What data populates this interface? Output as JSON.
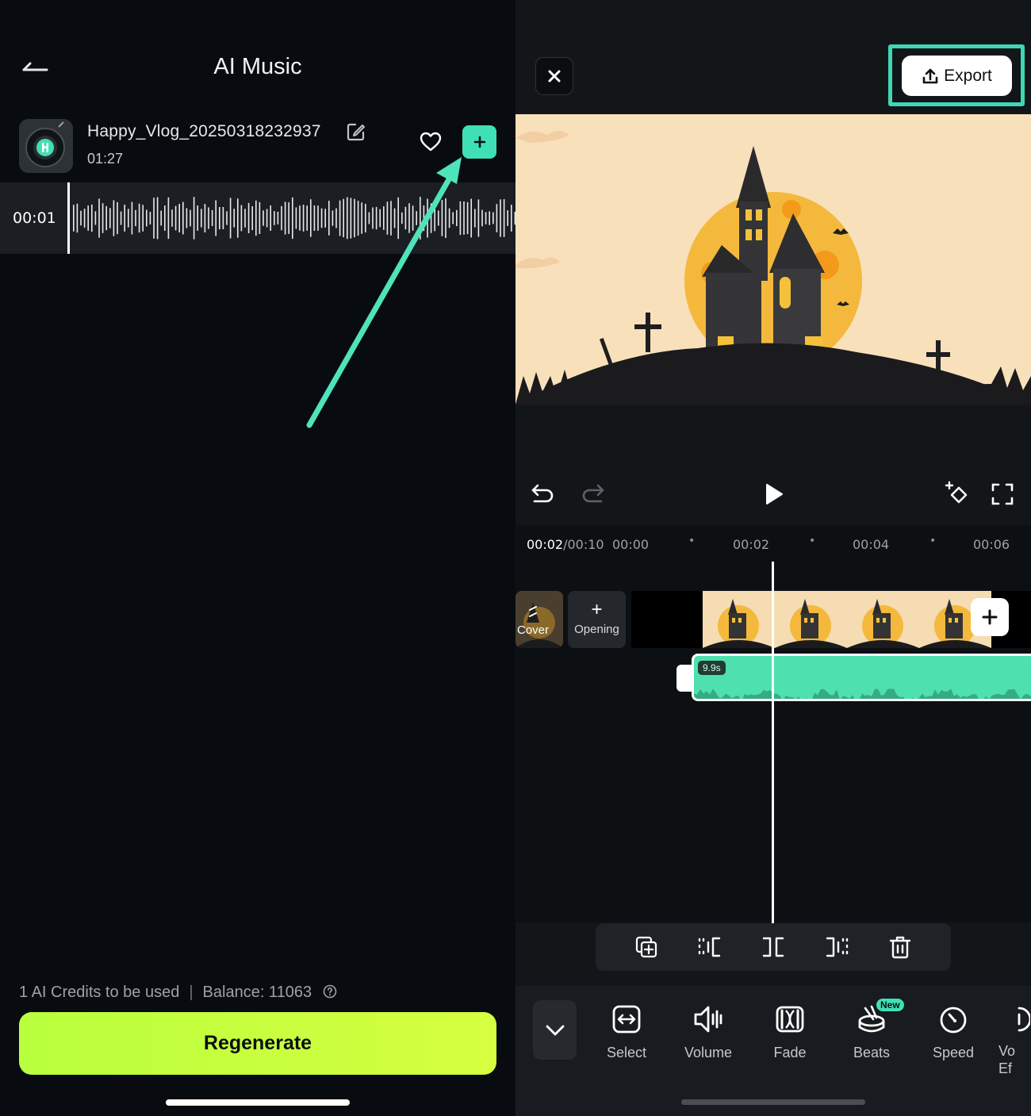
{
  "music_panel": {
    "title": "AI Music",
    "track": {
      "name": "Happy_Vlog_20250318232937",
      "duration": "01:27"
    },
    "waveform": {
      "current_time": "00:01"
    },
    "credits": {
      "used_text": "1 AI Credits to be used",
      "balance_text": "Balance: 11063"
    },
    "regenerate_label": "Regenerate"
  },
  "editor": {
    "export_label": "Export",
    "timecode": {
      "current": "00:02",
      "total": "/00:10",
      "ticks": [
        "00:00",
        "00:02",
        "00:04",
        "00:06"
      ]
    },
    "cover_label": "Cover",
    "opening_label": "Opening",
    "audio_clip_duration": "9.9s",
    "tools": [
      {
        "label": "Select",
        "icon": "select-icon"
      },
      {
        "label": "Volume",
        "icon": "volume-icon"
      },
      {
        "label": "Fade",
        "icon": "fade-icon"
      },
      {
        "label": "Beats",
        "icon": "beats-icon",
        "badge": "New"
      },
      {
        "label": "Speed",
        "icon": "speed-icon"
      },
      {
        "label": "Vo\nEf",
        "icon": "voice-effect-icon"
      }
    ]
  },
  "colors": {
    "accent_teal": "#3fe0b6",
    "regenerate_green": "#c6ff3c",
    "audio_clip": "#4fe0b0",
    "background": "#080c10"
  }
}
